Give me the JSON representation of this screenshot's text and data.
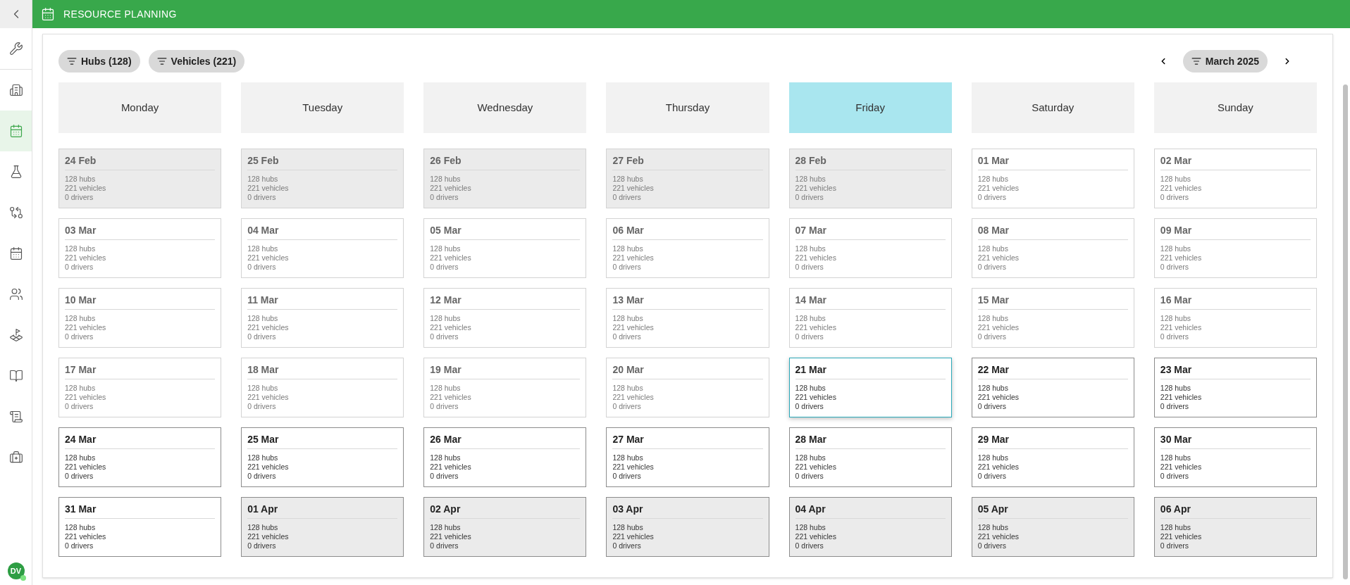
{
  "header": {
    "title": "RESOURCE PLANNING"
  },
  "sidebar": {
    "items": [
      {
        "selected": false
      },
      {
        "selected": false
      },
      {
        "selected": true
      },
      {
        "selected": false
      },
      {
        "selected": false
      },
      {
        "selected": false
      },
      {
        "selected": false
      },
      {
        "selected": false
      },
      {
        "selected": false
      },
      {
        "selected": false
      },
      {
        "selected": false
      }
    ],
    "avatar": {
      "initials": "DV",
      "online": true
    }
  },
  "filters": [
    "Hubs (128)",
    "Vehicles (221)"
  ],
  "month_picker": {
    "label": "March 2025"
  },
  "weekdays": [
    {
      "label": "Monday",
      "selected": false
    },
    {
      "label": "Tuesday",
      "selected": false
    },
    {
      "label": "Wednesday",
      "selected": false
    },
    {
      "label": "Thursday",
      "selected": false
    },
    {
      "label": "Friday",
      "selected": true
    },
    {
      "label": "Saturday",
      "selected": false
    },
    {
      "label": "Sunday",
      "selected": false
    }
  ],
  "days": [
    {
      "date": "24 Feb",
      "hubs": "128 hubs",
      "vehicles": "221 vehicles",
      "drivers": "0 drivers",
      "in_month": false,
      "past": true,
      "selected": false
    },
    {
      "date": "25 Feb",
      "hubs": "128 hubs",
      "vehicles": "221 vehicles",
      "drivers": "0 drivers",
      "in_month": false,
      "past": true,
      "selected": false
    },
    {
      "date": "26 Feb",
      "hubs": "128 hubs",
      "vehicles": "221 vehicles",
      "drivers": "0 drivers",
      "in_month": false,
      "past": true,
      "selected": false
    },
    {
      "date": "27 Feb",
      "hubs": "128 hubs",
      "vehicles": "221 vehicles",
      "drivers": "0 drivers",
      "in_month": false,
      "past": true,
      "selected": false
    },
    {
      "date": "28 Feb",
      "hubs": "128 hubs",
      "vehicles": "221 vehicles",
      "drivers": "0 drivers",
      "in_month": false,
      "past": true,
      "selected": false
    },
    {
      "date": "01 Mar",
      "hubs": "128 hubs",
      "vehicles": "221 vehicles",
      "drivers": "0 drivers",
      "in_month": true,
      "past": true,
      "selected": false
    },
    {
      "date": "02 Mar",
      "hubs": "128 hubs",
      "vehicles": "221 vehicles",
      "drivers": "0 drivers",
      "in_month": true,
      "past": true,
      "selected": false
    },
    {
      "date": "03 Mar",
      "hubs": "128 hubs",
      "vehicles": "221 vehicles",
      "drivers": "0 drivers",
      "in_month": true,
      "past": true,
      "selected": false
    },
    {
      "date": "04 Mar",
      "hubs": "128 hubs",
      "vehicles": "221 vehicles",
      "drivers": "0 drivers",
      "in_month": true,
      "past": true,
      "selected": false
    },
    {
      "date": "05 Mar",
      "hubs": "128 hubs",
      "vehicles": "221 vehicles",
      "drivers": "0 drivers",
      "in_month": true,
      "past": true,
      "selected": false
    },
    {
      "date": "06 Mar",
      "hubs": "128 hubs",
      "vehicles": "221 vehicles",
      "drivers": "0 drivers",
      "in_month": true,
      "past": true,
      "selected": false
    },
    {
      "date": "07 Mar",
      "hubs": "128 hubs",
      "vehicles": "221 vehicles",
      "drivers": "0 drivers",
      "in_month": true,
      "past": true,
      "selected": false
    },
    {
      "date": "08 Mar",
      "hubs": "128 hubs",
      "vehicles": "221 vehicles",
      "drivers": "0 drivers",
      "in_month": true,
      "past": true,
      "selected": false
    },
    {
      "date": "09 Mar",
      "hubs": "128 hubs",
      "vehicles": "221 vehicles",
      "drivers": "0 drivers",
      "in_month": true,
      "past": true,
      "selected": false
    },
    {
      "date": "10 Mar",
      "hubs": "128 hubs",
      "vehicles": "221 vehicles",
      "drivers": "0 drivers",
      "in_month": true,
      "past": true,
      "selected": false
    },
    {
      "date": "11 Mar",
      "hubs": "128 hubs",
      "vehicles": "221 vehicles",
      "drivers": "0 drivers",
      "in_month": true,
      "past": true,
      "selected": false
    },
    {
      "date": "12 Mar",
      "hubs": "128 hubs",
      "vehicles": "221 vehicles",
      "drivers": "0 drivers",
      "in_month": true,
      "past": true,
      "selected": false
    },
    {
      "date": "13 Mar",
      "hubs": "128 hubs",
      "vehicles": "221 vehicles",
      "drivers": "0 drivers",
      "in_month": true,
      "past": true,
      "selected": false
    },
    {
      "date": "14 Mar",
      "hubs": "128 hubs",
      "vehicles": "221 vehicles",
      "drivers": "0 drivers",
      "in_month": true,
      "past": true,
      "selected": false
    },
    {
      "date": "15 Mar",
      "hubs": "128 hubs",
      "vehicles": "221 vehicles",
      "drivers": "0 drivers",
      "in_month": true,
      "past": true,
      "selected": false
    },
    {
      "date": "16 Mar",
      "hubs": "128 hubs",
      "vehicles": "221 vehicles",
      "drivers": "0 drivers",
      "in_month": true,
      "past": true,
      "selected": false
    },
    {
      "date": "17 Mar",
      "hubs": "128 hubs",
      "vehicles": "221 vehicles",
      "drivers": "0 drivers",
      "in_month": true,
      "past": true,
      "selected": false
    },
    {
      "date": "18 Mar",
      "hubs": "128 hubs",
      "vehicles": "221 vehicles",
      "drivers": "0 drivers",
      "in_month": true,
      "past": true,
      "selected": false
    },
    {
      "date": "19 Mar",
      "hubs": "128 hubs",
      "vehicles": "221 vehicles",
      "drivers": "0 drivers",
      "in_month": true,
      "past": true,
      "selected": false
    },
    {
      "date": "20 Mar",
      "hubs": "128 hubs",
      "vehicles": "221 vehicles",
      "drivers": "0 drivers",
      "in_month": true,
      "past": true,
      "selected": false
    },
    {
      "date": "21 Mar",
      "hubs": "128 hubs",
      "vehicles": "221 vehicles",
      "drivers": "0 drivers",
      "in_month": true,
      "past": false,
      "selected": true
    },
    {
      "date": "22 Mar",
      "hubs": "128 hubs",
      "vehicles": "221 vehicles",
      "drivers": "0 drivers",
      "in_month": true,
      "past": false,
      "selected": false
    },
    {
      "date": "23 Mar",
      "hubs": "128 hubs",
      "vehicles": "221 vehicles",
      "drivers": "0 drivers",
      "in_month": true,
      "past": false,
      "selected": false
    },
    {
      "date": "24 Mar",
      "hubs": "128 hubs",
      "vehicles": "221 vehicles",
      "drivers": "0 drivers",
      "in_month": true,
      "past": false,
      "selected": false
    },
    {
      "date": "25 Mar",
      "hubs": "128 hubs",
      "vehicles": "221 vehicles",
      "drivers": "0 drivers",
      "in_month": true,
      "past": false,
      "selected": false
    },
    {
      "date": "26 Mar",
      "hubs": "128 hubs",
      "vehicles": "221 vehicles",
      "drivers": "0 drivers",
      "in_month": true,
      "past": false,
      "selected": false
    },
    {
      "date": "27 Mar",
      "hubs": "128 hubs",
      "vehicles": "221 vehicles",
      "drivers": "0 drivers",
      "in_month": true,
      "past": false,
      "selected": false
    },
    {
      "date": "28 Mar",
      "hubs": "128 hubs",
      "vehicles": "221 vehicles",
      "drivers": "0 drivers",
      "in_month": true,
      "past": false,
      "selected": false
    },
    {
      "date": "29 Mar",
      "hubs": "128 hubs",
      "vehicles": "221 vehicles",
      "drivers": "0 drivers",
      "in_month": true,
      "past": false,
      "selected": false
    },
    {
      "date": "30 Mar",
      "hubs": "128 hubs",
      "vehicles": "221 vehicles",
      "drivers": "0 drivers",
      "in_month": true,
      "past": false,
      "selected": false
    },
    {
      "date": "31 Mar",
      "hubs": "128 hubs",
      "vehicles": "221 vehicles",
      "drivers": "0 drivers",
      "in_month": true,
      "past": false,
      "selected": false
    },
    {
      "date": "01 Apr",
      "hubs": "128 hubs",
      "vehicles": "221 vehicles",
      "drivers": "0 drivers",
      "in_month": false,
      "past": false,
      "selected": false
    },
    {
      "date": "02 Apr",
      "hubs": "128 hubs",
      "vehicles": "221 vehicles",
      "drivers": "0 drivers",
      "in_month": false,
      "past": false,
      "selected": false
    },
    {
      "date": "03 Apr",
      "hubs": "128 hubs",
      "vehicles": "221 vehicles",
      "drivers": "0 drivers",
      "in_month": false,
      "past": false,
      "selected": false
    },
    {
      "date": "04 Apr",
      "hubs": "128 hubs",
      "vehicles": "221 vehicles",
      "drivers": "0 drivers",
      "in_month": false,
      "past": false,
      "selected": false
    },
    {
      "date": "05 Apr",
      "hubs": "128 hubs",
      "vehicles": "221 vehicles",
      "drivers": "0 drivers",
      "in_month": false,
      "past": false,
      "selected": false
    },
    {
      "date": "06 Apr",
      "hubs": "128 hubs",
      "vehicles": "221 vehicles",
      "drivers": "0 drivers",
      "in_month": false,
      "past": false,
      "selected": false
    }
  ]
}
